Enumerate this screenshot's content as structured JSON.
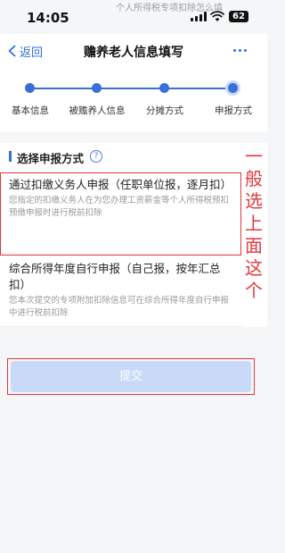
{
  "status_bar": {
    "time": "14:05",
    "overlay_text": "个人所得税专项扣除怎么填",
    "battery": "62"
  },
  "nav": {
    "back_label": "返回",
    "title": "赡养老人信息填写",
    "more_icon": "more-horizontal-icon"
  },
  "stepper": {
    "steps": [
      {
        "label": "基本信息",
        "state": "done"
      },
      {
        "label": "被赡养人信息",
        "state": "done"
      },
      {
        "label": "分摊方式",
        "state": "done"
      },
      {
        "label": "申报方式",
        "state": "current"
      }
    ],
    "accent": "#3a6fd8"
  },
  "section": {
    "title": "选择申报方式",
    "help_icon": "question-circle-icon"
  },
  "options": [
    {
      "title": "通过扣缴义务人申报（任职单位报，逐月扣）",
      "description": "您指定的扣缴义务人在为您办理工资薪金等个人所得税预扣预缴申报时进行税前扣除"
    },
    {
      "title": "综合所得年度自行申报（自己报，按年汇总扣）",
      "description": "您本次提交的专项附加扣除信息可在综合所得年度自行申报中进行税前扣除"
    }
  ],
  "annotation": {
    "chars": [
      "一",
      "般",
      "选",
      "上",
      "面",
      "这",
      "个"
    ],
    "color": "#e0393e"
  },
  "submit": {
    "label": "提交"
  }
}
